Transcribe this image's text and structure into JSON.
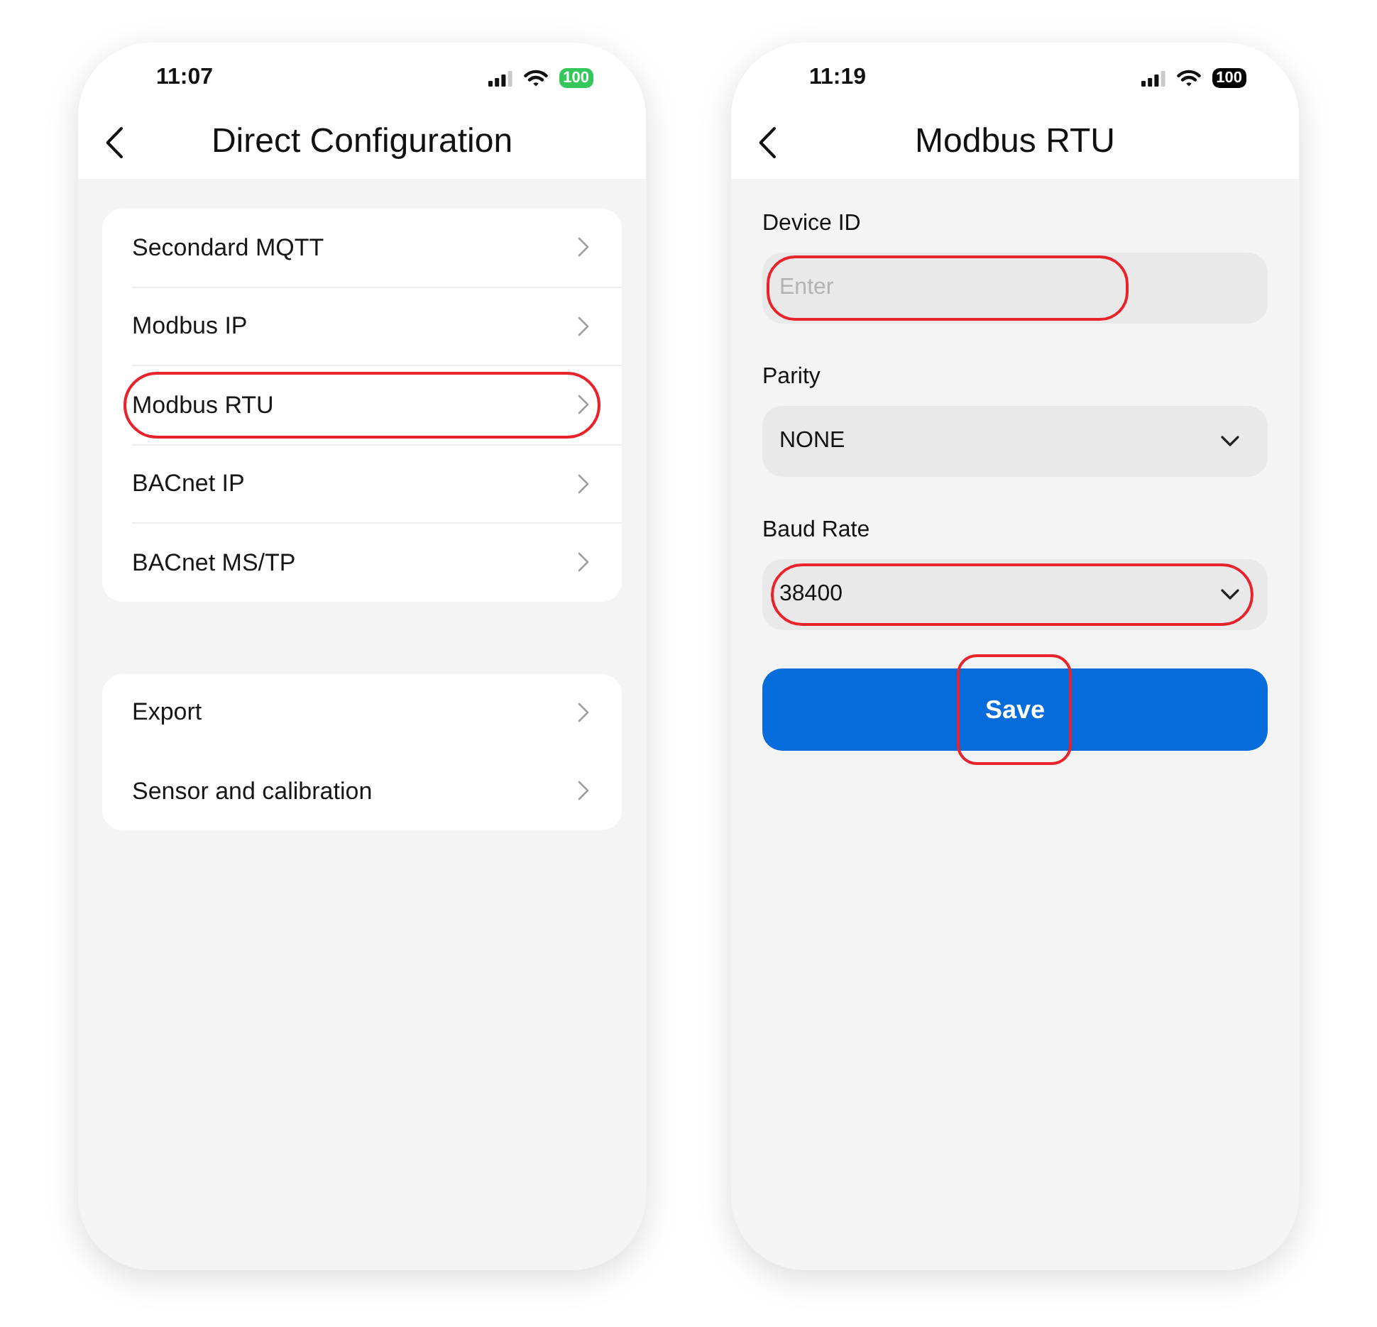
{
  "screens": [
    {
      "kind": "menu",
      "status_bar": {
        "time": "11:07",
        "battery": {
          "text": "100",
          "color": "#34c759"
        }
      },
      "header": {
        "title": "Direct Configuration"
      },
      "groups": [
        {
          "dividers": true,
          "items": [
            {
              "label": "Secondard MQTT",
              "highlighted": false
            },
            {
              "label": "Modbus IP",
              "highlighted": false
            },
            {
              "label": "Modbus RTU",
              "highlighted": true
            },
            {
              "label": "BACnet IP",
              "highlighted": false
            },
            {
              "label": "BACnet MS/TP",
              "highlighted": false
            }
          ]
        },
        {
          "dividers": false,
          "items": [
            {
              "label": "Export",
              "highlighted": false
            },
            {
              "label": "Sensor and calibration",
              "highlighted": false
            }
          ]
        }
      ]
    },
    {
      "kind": "form",
      "status_bar": {
        "time": "11:19",
        "battery": {
          "text": "100",
          "color": "#000000"
        }
      },
      "header": {
        "title": "Modbus RTU"
      },
      "fields": [
        {
          "kind": "input",
          "label": "Device ID",
          "placeholder": "Enter",
          "highlighted": true
        },
        {
          "kind": "select",
          "label": "Parity",
          "value": "NONE",
          "highlighted": false
        },
        {
          "kind": "select",
          "label": "Baud Rate",
          "value": "38400",
          "highlighted": true
        }
      ],
      "save_button": {
        "label": "Save",
        "highlighted": true
      }
    }
  ]
}
